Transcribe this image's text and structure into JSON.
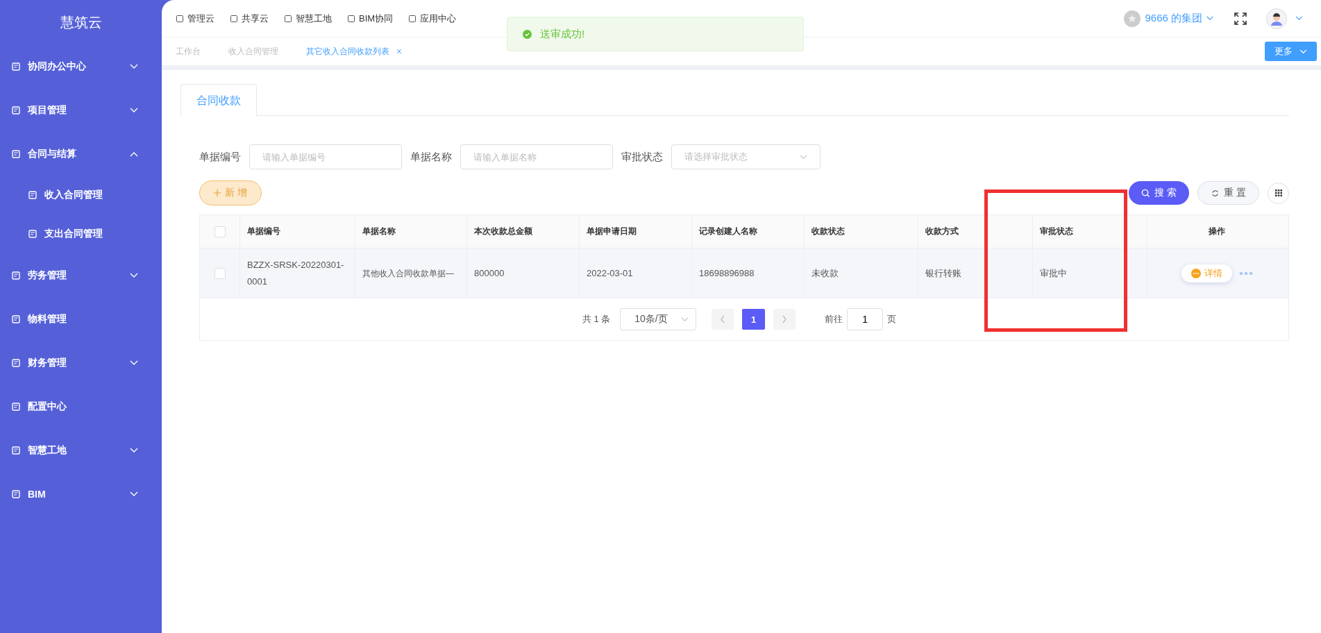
{
  "sidebar": {
    "logo": "慧筑云",
    "items": [
      {
        "label": "协同办公中心",
        "kind": "group",
        "expanded": false
      },
      {
        "label": "项目管理",
        "kind": "group",
        "expanded": false
      },
      {
        "label": "合同与结算",
        "kind": "group",
        "expanded": true,
        "children": [
          {
            "label": "收入合同管理"
          },
          {
            "label": "支出合同管理"
          }
        ]
      },
      {
        "label": "劳务管理",
        "kind": "group",
        "expanded": false
      },
      {
        "label": "物料管理",
        "kind": "link"
      },
      {
        "label": "财务管理",
        "kind": "group",
        "expanded": false
      },
      {
        "label": "配置中心",
        "kind": "link"
      },
      {
        "label": "智慧工地",
        "kind": "group",
        "expanded": false
      },
      {
        "label": "BIM",
        "kind": "group",
        "expanded": false
      }
    ]
  },
  "topnav": [
    "管理云",
    "共享云",
    "智慧工地",
    "BIM协同",
    "应用中心"
  ],
  "org": "9666 的集团",
  "page_tabs": [
    {
      "label": "工作台",
      "selected": false
    },
    {
      "label": "收入合同管理",
      "selected": false
    },
    {
      "label": "其它收入合同收款列表",
      "selected": true
    }
  ],
  "more_button": "更多",
  "toast": "送审成功!",
  "content_tabs": [
    {
      "label": "合同收款",
      "selected": true
    }
  ],
  "filters": [
    {
      "label": "单据编号",
      "placeholder": "请输入单据编号",
      "kind": "input"
    },
    {
      "label": "单据名称",
      "placeholder": "请输入单据名称",
      "kind": "input"
    },
    {
      "label": "审批状态",
      "placeholder": "请选择审批状态",
      "kind": "select"
    }
  ],
  "add_button": "新 增",
  "search_button": "搜 索",
  "reset_button": "重 置",
  "table": {
    "all_checked": false,
    "columns": [
      "单据编号",
      "单据名称",
      "本次收款总金额",
      "单据申请日期",
      "记录创建人名称",
      "收款状态",
      "收款方式",
      "审批状态",
      "操作"
    ],
    "rows": [
      {
        "checked": false,
        "cells": [
          "BZZX-SRSK-20220301-0001",
          "其他收入合同收款单据—",
          "800000",
          "2022-03-01",
          "18698896988",
          "未收款",
          "银行转账",
          "审批中"
        ],
        "action": "详情"
      }
    ]
  },
  "pagination": {
    "total": "共 1 条",
    "page_size": "10条/页",
    "pages": [
      {
        "label": "1",
        "selected": true
      }
    ],
    "goto_label": "前往",
    "goto_value": "1",
    "goto_suffix": "页"
  }
}
